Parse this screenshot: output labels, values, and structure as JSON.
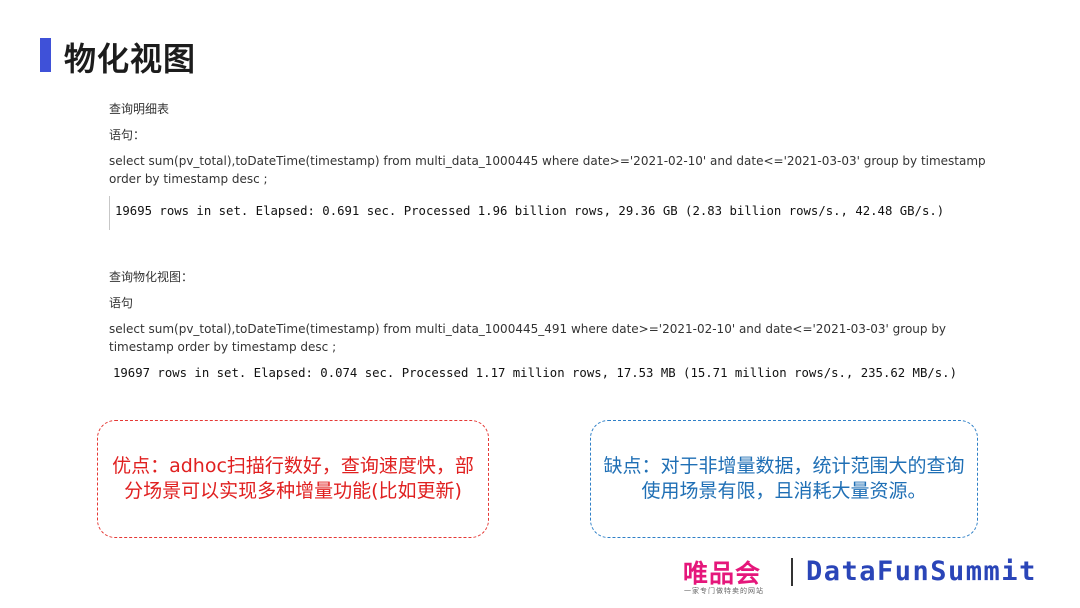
{
  "page": {
    "title": "物化视图"
  },
  "detail_query": {
    "heading": "查询明细表",
    "statement_label": "语句：",
    "sql": "select sum(pv_total),toDateTime(timestamp) from multi_data_1000445 where date>='2021-02-10' and date<='2021-03-03' group by timestamp order by timestamp desc ;",
    "result": "19695 rows in set. Elapsed: 0.691 sec. Processed 1.96 billion rows, 29.36 GB (2.83 billion rows/s., 42.48 GB/s.)"
  },
  "mv_query": {
    "heading": "查询物化视图：",
    "statement_label": "语句",
    "sql": "select sum(pv_total),toDateTime(timestamp) from multi_data_1000445_491 where date>='2021-02-10' and date<='2021-03-03' group by timestamp order by timestamp desc ;",
    "result": "19697 rows in set. Elapsed: 0.074 sec. Processed 1.17 million rows, 17.53 MB (15.71 million rows/s., 235.62 MB/s.)"
  },
  "pros": {
    "text": "优点：adhoc扫描行数好，查询速度快，部分场景可以实现多种增量功能(比如更新)"
  },
  "cons": {
    "text": "缺点：对于非增量数据，统计范围大的查询使用场景有限，且消耗大量资源。"
  },
  "footer": {
    "brand_vip": "唯品会",
    "brand_vip_slogan": "一家专门做特卖的网站",
    "brand_dfs": "DataFunSummit"
  },
  "colors": {
    "accent_bar": "#3f51d8",
    "pros": "#e02020",
    "cons": "#1f6fb5",
    "vip_brand": "#e5177b",
    "dfs_brand": "#2a45b8"
  }
}
